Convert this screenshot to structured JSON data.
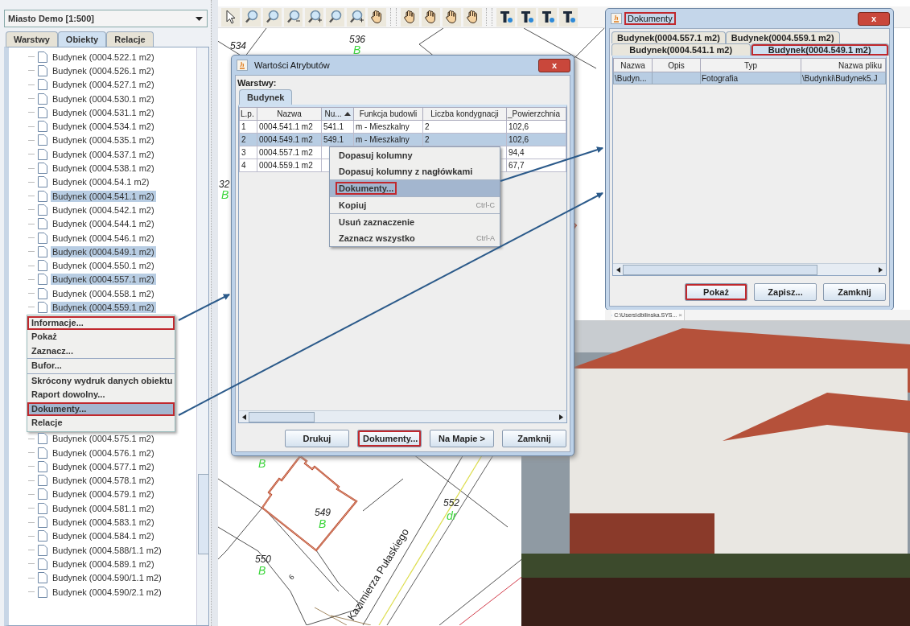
{
  "layer_selector": {
    "value": "Miasto Demo [1:500]"
  },
  "side_tabs": [
    {
      "label": "Warstwy",
      "selected": false
    },
    {
      "label": "Obiekty",
      "selected": true
    },
    {
      "label": "Relacje",
      "selected": false
    }
  ],
  "tree": {
    "items_above": [
      {
        "label": "Budynek (0004.522.1 m2)",
        "selected": false
      },
      {
        "label": "Budynek (0004.526.1 m2)",
        "selected": false
      },
      {
        "label": "Budynek (0004.527.1 m2)",
        "selected": false
      },
      {
        "label": "Budynek (0004.530.1 m2)",
        "selected": false
      },
      {
        "label": "Budynek (0004.531.1 m2)",
        "selected": false
      },
      {
        "label": "Budynek (0004.534.1 m2)",
        "selected": false
      },
      {
        "label": "Budynek (0004.535.1 m2)",
        "selected": false
      },
      {
        "label": "Budynek (0004.537.1 m2)",
        "selected": false
      },
      {
        "label": "Budynek (0004.538.1 m2)",
        "selected": false
      },
      {
        "label": "Budynek (0004.54.1 m2)",
        "selected": false
      },
      {
        "label": "Budynek (0004.541.1 m2)",
        "selected": true
      },
      {
        "label": "Budynek (0004.542.1 m2)",
        "selected": false
      },
      {
        "label": "Budynek (0004.544.1 m2)",
        "selected": false
      },
      {
        "label": "Budynek (0004.546.1 m2)",
        "selected": false
      },
      {
        "label": "Budynek (0004.549.1 m2)",
        "selected": true
      },
      {
        "label": "Budynek (0004.550.1 m2)",
        "selected": false
      },
      {
        "label": "Budynek (0004.557.1 m2)",
        "selected": true
      },
      {
        "label": "Budynek (0004.558.1 m2)",
        "selected": false
      },
      {
        "label": "Budynek (0004.559.1 m2)",
        "selected": true
      }
    ],
    "context_menu": [
      {
        "label": "Informacje...",
        "selected": false,
        "highlighted": true,
        "separator_before": false
      },
      {
        "label": "Pokaż",
        "selected": false,
        "highlighted": false,
        "separator_before": false
      },
      {
        "label": "Zaznacz...",
        "selected": false,
        "highlighted": false,
        "separator_before": false
      },
      {
        "label": "Bufor...",
        "selected": false,
        "highlighted": false,
        "separator_before": true
      },
      {
        "label": "Skrócony wydruk danych obiektu",
        "selected": false,
        "highlighted": false,
        "separator_before": true
      },
      {
        "label": "Raport dowolny...",
        "selected": false,
        "highlighted": false,
        "separator_before": false
      },
      {
        "label": "Dokumenty...",
        "selected": true,
        "highlighted": true,
        "separator_before": false
      },
      {
        "label": "Relacje",
        "selected": false,
        "highlighted": false,
        "separator_before": false
      }
    ],
    "items_below": [
      {
        "label": "Budynek (0004.575.1 m2)",
        "selected": false
      },
      {
        "label": "Budynek (0004.576.1 m2)",
        "selected": false
      },
      {
        "label": "Budynek (0004.577.1 m2)",
        "selected": false
      },
      {
        "label": "Budynek (0004.578.1 m2)",
        "selected": false
      },
      {
        "label": "Budynek (0004.579.1 m2)",
        "selected": false
      },
      {
        "label": "Budynek (0004.581.1 m2)",
        "selected": false
      },
      {
        "label": "Budynek (0004.583.1 m2)",
        "selected": false
      },
      {
        "label": "Budynek (0004.584.1 m2)",
        "selected": false
      },
      {
        "label": "Budynek (0004.588/1.1 m2)",
        "selected": false
      },
      {
        "label": "Budynek (0004.589.1 m2)",
        "selected": false
      },
      {
        "label": "Budynek (0004.590/1.1 m2)",
        "selected": false
      },
      {
        "label": "Budynek (0004.590/2.1 m2)",
        "selected": false
      }
    ]
  },
  "map": {
    "labels": [
      {
        "text": "534",
        "kind": "number"
      },
      {
        "text": "536",
        "kind": "number"
      },
      {
        "text": "B",
        "kind": "use"
      },
      {
        "text": "32",
        "kind": "number"
      },
      {
        "text": "B",
        "kind": "use"
      },
      {
        "text": "B",
        "kind": "use"
      },
      {
        "text": "549",
        "kind": "number"
      },
      {
        "text": "B",
        "kind": "use"
      },
      {
        "text": "550",
        "kind": "number"
      },
      {
        "text": "B",
        "kind": "use"
      },
      {
        "text": "6",
        "kind": "small"
      },
      {
        "text": "552",
        "kind": "number"
      },
      {
        "text": "dr",
        "kind": "use"
      },
      {
        "text": "Kazimierza Pułaskiego",
        "kind": "street"
      }
    ]
  },
  "attributes_dialog": {
    "title": "Wartości Atrybutów",
    "close": "x",
    "layers_label": "Warstwy:",
    "tabs": [
      {
        "label": "Budynek",
        "selected": true
      }
    ],
    "columns": [
      {
        "label": "L.p.",
        "sorted": false
      },
      {
        "label": "Nazwa",
        "sorted": false
      },
      {
        "label": "Nu...",
        "sorted": true
      },
      {
        "label": "Funkcja budowli",
        "sorted": false
      },
      {
        "label": "Liczba kondygnacji",
        "sorted": false
      },
      {
        "label": "_Powierzchnia",
        "sorted": false
      }
    ],
    "rows": [
      {
        "cells": [
          "1",
          "0004.541.1 m2",
          "541.1",
          "m - Mieszkalny",
          "2",
          "102,6"
        ],
        "selected": false
      },
      {
        "cells": [
          "2",
          "0004.549.1 m2",
          "549.1",
          "m - Mieszkalny",
          "2",
          "102,6"
        ],
        "selected": true
      },
      {
        "cells": [
          "3",
          "0004.557.1 m2",
          null,
          null,
          null,
          "94,4"
        ],
        "selected": false
      },
      {
        "cells": [
          "4",
          "0004.559.1 m2",
          null,
          null,
          null,
          "67,7"
        ],
        "selected": false
      }
    ],
    "context_menu": [
      {
        "label": "Dopasuj kolumny",
        "selected": false,
        "highlighted": false,
        "separator_before": false
      },
      {
        "label": "Dopasuj kolumny z nagłówkami",
        "selected": false,
        "highlighted": false,
        "separator_before": false
      },
      {
        "label": "Dokumenty...",
        "selected": true,
        "highlighted": true,
        "separator_before": true
      },
      {
        "label": "Kopiuj",
        "shortcut": "Ctrl-C",
        "selected": false,
        "highlighted": false,
        "separator_before": true
      },
      {
        "label": "Usuń zaznaczenie",
        "selected": false,
        "highlighted": false,
        "separator_before": true
      },
      {
        "label": "Zaznacz wszystko",
        "shortcut": "Ctrl-A",
        "selected": false,
        "highlighted": false,
        "separator_before": false
      }
    ],
    "buttons": [
      {
        "label": "Drukuj",
        "highlighted": false
      },
      {
        "label": "Dokumenty...",
        "highlighted": true
      },
      {
        "label": "Na Mapie >",
        "highlighted": false
      },
      {
        "label": "Zamknij",
        "highlighted": false
      }
    ]
  },
  "documents_window": {
    "title": "Dokumenty",
    "title_highlighted": true,
    "close": "x",
    "tab_rows": [
      [
        {
          "label": "Budynek(0004.557.1 m2)",
          "selected": false,
          "highlighted": false
        },
        {
          "label": "Budynek(0004.559.1 m2)",
          "selected": false,
          "highlighted": false
        }
      ],
      [
        {
          "label": "Budynek(0004.541.1 m2)",
          "selected": false,
          "highlighted": false
        },
        {
          "label": "Budynek(0004.549.1 m2)",
          "selected": true,
          "highlighted": true
        }
      ]
    ],
    "columns": [
      "Nazwa",
      "Opis",
      "Typ",
      "Nazwa pliku"
    ],
    "rows": [
      {
        "cells": [
          "\\Budyn...",
          null,
          "Fotografia",
          "\\Budynki\\Budynek5.J"
        ],
        "selected": true
      }
    ],
    "buttons": [
      {
        "label": "Pokaż",
        "highlighted": true
      },
      {
        "label": "Zapisz...",
        "highlighted": false
      },
      {
        "label": "Zamknij",
        "highlighted": false
      }
    ]
  },
  "taskbar_tab": {
    "label": "C:\\Users\\dbilinska.SYS...",
    "close": "×"
  }
}
